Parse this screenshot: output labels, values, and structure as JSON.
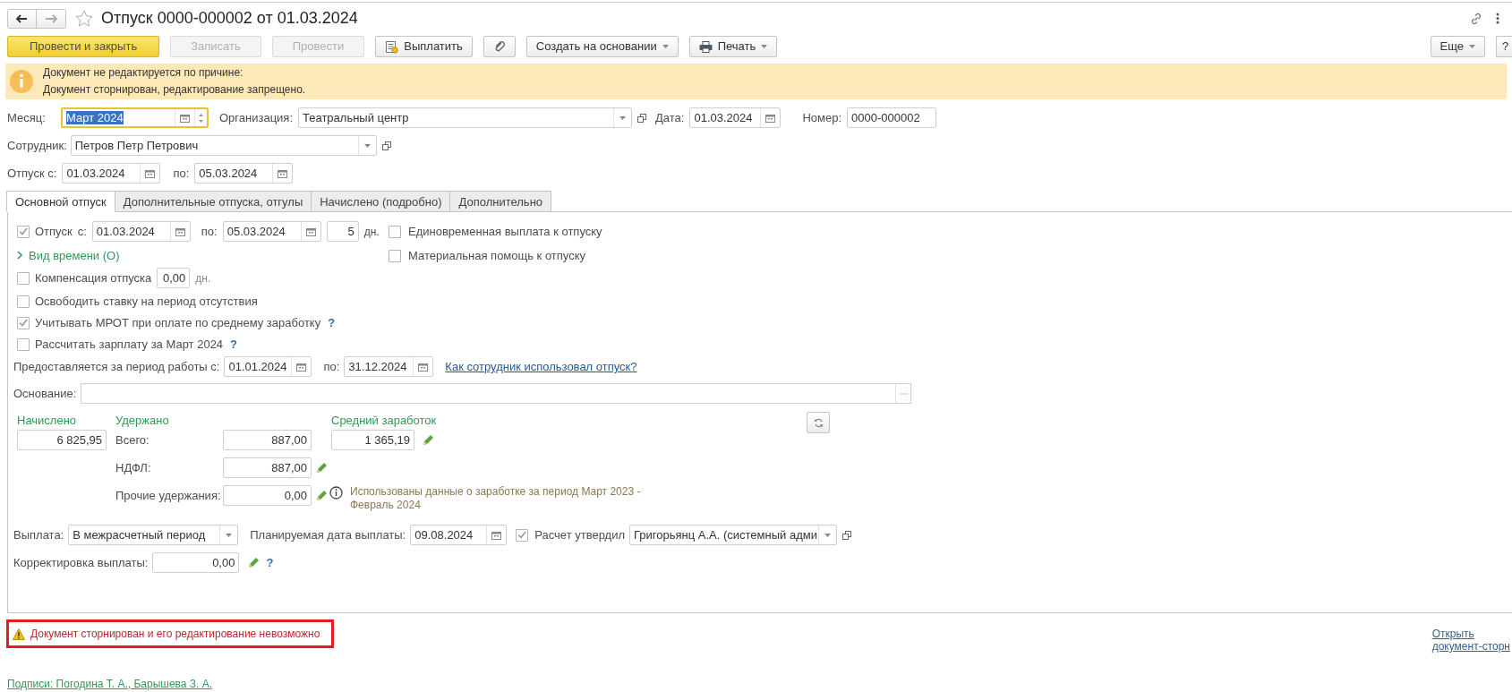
{
  "window": {
    "title": "Отпуск 0000-000002 от 01.03.2024"
  },
  "toolbar": [
    {
      "kind": "primary",
      "label": "Провести и закрыть",
      "disabled": false
    },
    {
      "kind": "plain",
      "label": "Записать",
      "disabled": true
    },
    {
      "kind": "plain",
      "label": "Провести",
      "disabled": true
    },
    {
      "kind": "pay",
      "label": "Выплатить",
      "disabled": false
    },
    {
      "kind": "attach",
      "disabled": false
    },
    {
      "kind": "menu",
      "label": "Создать на основании",
      "disabled": false
    },
    {
      "kind": "print",
      "label": "Печать",
      "disabled": false
    }
  ],
  "more_button": {
    "label": "Еще"
  },
  "help_button": {
    "label": "?"
  },
  "notice": {
    "lines": [
      "Документ не редактируется по причине:",
      "Документ сторнирован, редактирование запрещено."
    ]
  },
  "header": {
    "month": {
      "label": "Месяц:",
      "value": "Март 2024",
      "focused": true
    },
    "organization": {
      "label": "Организация:",
      "value": "Театральный центр"
    },
    "date": {
      "label": "Дата:",
      "value": "01.03.2024"
    },
    "number": {
      "label": "Номер:",
      "value": "0000-000002"
    },
    "employee": {
      "label": "Сотрудник:",
      "value": "Петров Петр Петрович"
    },
    "period": {
      "label": "Отпуск с:",
      "from": "01.03.2024",
      "to_label": "по:",
      "to": "05.03.2024"
    }
  },
  "tabs": [
    {
      "label": "Основной отпуск",
      "selected": true
    },
    {
      "label": "Дополнительные отпуска, отгулы",
      "selected": false
    },
    {
      "label": "Начислено (подробно)",
      "selected": false
    },
    {
      "label": "Дополнительно",
      "selected": false
    }
  ],
  "main_tab": {
    "vacation": {
      "label": "Отпуск",
      "checked": true,
      "from_label": "с:",
      "from": "01.03.2024",
      "to_label": "по:",
      "to": "05.03.2024",
      "days": "5",
      "days_unit": "дн."
    },
    "right_checks": [
      {
        "label": "Единовременная выплата к отпуску",
        "checked": false
      },
      {
        "label": "Материальная помощь к отпуску",
        "checked": false
      }
    ],
    "time_kind": {
      "label": "Вид времени (О)",
      "expanded": false
    },
    "compensation": {
      "label": "Компенсация отпуска",
      "checked": false,
      "value": "0,00",
      "unit": "дн."
    },
    "options": [
      {
        "label": "Освободить ставку на период отсутствия",
        "checked": false
      },
      {
        "label": "Учитывать МРОТ при оплате по среднему заработку",
        "checked": true,
        "help": "?"
      },
      {
        "label": "Рассчитать зарплату за Март 2024",
        "checked": false,
        "help": "?"
      }
    ],
    "work_period": {
      "label": "Предоставляется за период работы с:",
      "from": "01.01.2024",
      "to_label": "по:",
      "to": "31.12.2024",
      "link": "Как сотрудник использовал отпуск?"
    },
    "basis": {
      "label": "Основание:"
    },
    "accrued": {
      "heading": "Начислено",
      "value": "6 825,95"
    },
    "withheld": {
      "heading": "Удержано",
      "rows": [
        {
          "label": "Всего:",
          "value": "887,00",
          "editable": false
        },
        {
          "label": "НДФЛ:",
          "value": "887,00",
          "editable": true
        },
        {
          "label": "Прочие удержания:",
          "value": "0,00",
          "editable": true
        }
      ]
    },
    "average": {
      "heading": "Средний заработок",
      "value": "1 365,19",
      "editable": true,
      "note": "Использованы данные о заработке за период Март 2023 - Февраль 2024"
    },
    "payment": {
      "label": "Выплата:",
      "value": "В межрасчетный период",
      "date_label": "Планируемая дата выплаты:",
      "date": "09.08.2024",
      "approved_label": "Расчет утвердил",
      "approved": true,
      "approver": "Григорьянц А.А. (системный адми"
    },
    "adjustment": {
      "label": "Корректировка выплаты:",
      "value": "0,00",
      "help": "?"
    }
  },
  "warning": {
    "text": "Документ сторнирован и его редактирование невозможно"
  },
  "open_link": {
    "lines": [
      "Открыть",
      "документ-сторн"
    ]
  },
  "signatures": {
    "text": "Подписи: Погодина Т. А., Барышева З. А."
  }
}
